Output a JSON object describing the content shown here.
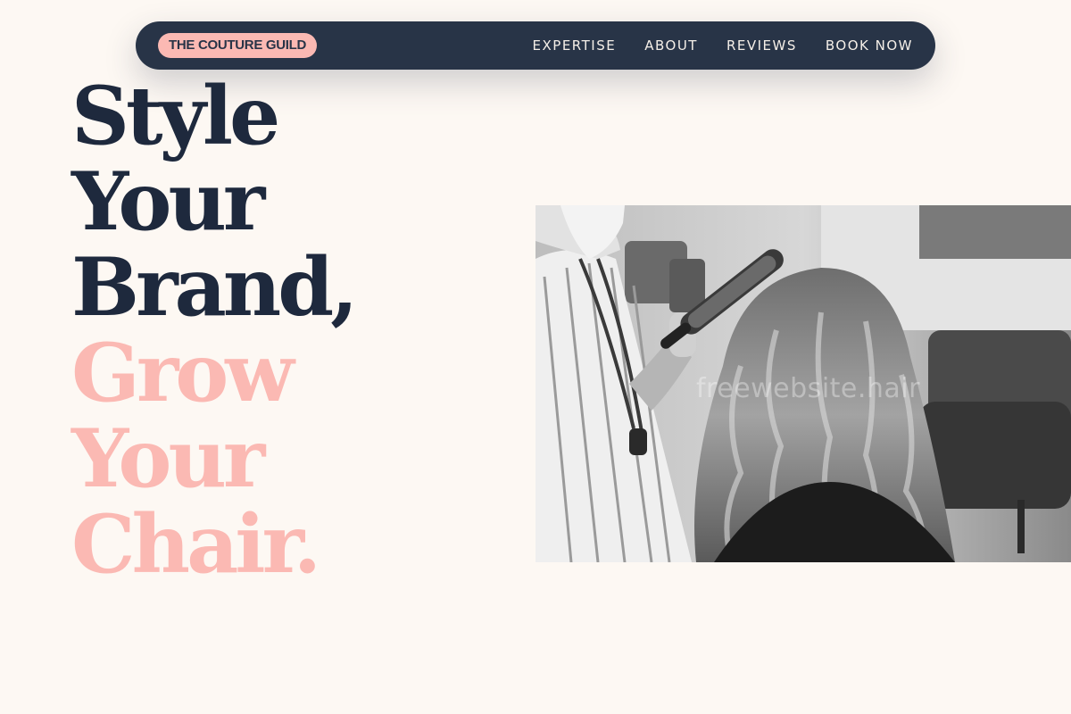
{
  "nav": {
    "logo": "THE COUTURE GUILD",
    "links": [
      "EXPERTISE",
      "ABOUT",
      "REVIEWS",
      "BOOK NOW"
    ]
  },
  "hero": {
    "line1": "Style",
    "line2": "Your",
    "line3": "Brand,",
    "line4": "Grow",
    "line5": "Your",
    "line6": "Chair."
  },
  "photo": {
    "watermark": "freewebsite.hair"
  },
  "colors": {
    "background": "#fdf8f3",
    "navy": "#283447",
    "headline_dark": "#1e293d",
    "accent_pink": "#fbb9b3"
  }
}
